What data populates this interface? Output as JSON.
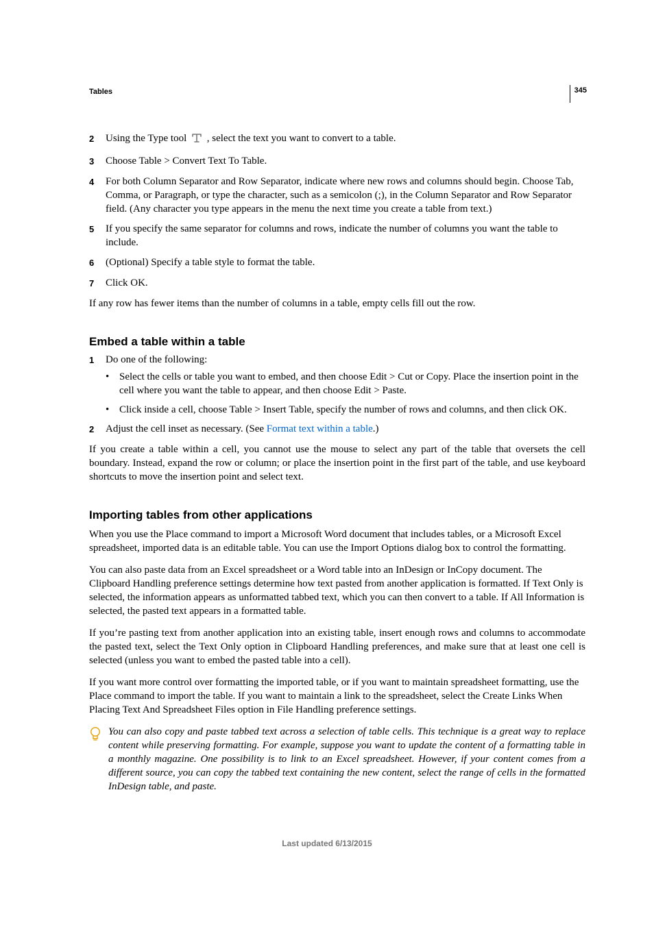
{
  "page_number": "345",
  "section": "Tables",
  "steps_a": [
    {
      "n": "2",
      "before": "Using the Type tool ",
      "after": " , select the text you want to convert to a table."
    },
    {
      "n": "3",
      "text": "Choose Table > Convert Text To Table."
    },
    {
      "n": "4",
      "text": "For both Column Separator and Row Separator, indicate where new rows and columns should begin. Choose Tab, Comma, or Paragraph, or type the character, such as a semicolon (;), in the Column Separator and Row Separator field. (Any character you type appears in the menu the next time you create a table from text.)"
    },
    {
      "n": "5",
      "text": "If you specify the same separator for columns and rows, indicate the number of columns you want the table to include."
    },
    {
      "n": "6",
      "text": "(Optional) Specify a table style to format the table."
    },
    {
      "n": "7",
      "text": "Click OK."
    }
  ],
  "para_after_a": "If any row has fewer items than the number of columns in a table, empty cells fill out the row.",
  "h2_embed": "Embed a table within a table",
  "embed_step1_intro": "Do one of the following:",
  "embed_bullets": [
    "Select the cells or table you want to embed, and then choose Edit > Cut or Copy. Place the insertion point in the cell where you want the table to appear, and then choose Edit > Paste.",
    "Click inside a cell, choose Table > Insert Table, specify the number of rows and columns, and then click OK."
  ],
  "embed_step2_before": "Adjust the cell inset as necessary. (See ",
  "embed_step2_link": "Format text within a table",
  "embed_step2_after": ".)",
  "embed_para": "If you create a table within a cell, you cannot use the mouse to select any part of the table that oversets the cell boundary. Instead, expand the row or column; or place the insertion point in the first part of the table, and use keyboard shortcuts to move the insertion point and select text.",
  "h2_import": "Importing tables from other applications",
  "import_p1": "When you use the Place command to import a Microsoft Word document that includes tables, or a Microsoft Excel spreadsheet, imported data is an editable table. You can use the Import Options dialog box to control the formatting.",
  "import_p2": "You can also paste data from an Excel spreadsheet or a Word table into an InDesign or InCopy document. The Clipboard Handling preference settings determine how text pasted from another application is formatted. If Text Only is selected, the information appears as unformatted tabbed text, which you can then convert to a table. If All Information is selected, the pasted text appears in a formatted table.",
  "import_p3": "If you’re pasting text from another application into an existing table, insert enough rows and columns to accommodate the pasted text, select the Text Only option in Clipboard Handling preferences, and make sure that at least one cell is selected (unless you want to embed the pasted table into a cell).",
  "import_p4": "If you want more control over formatting the imported table, or if you want to maintain spreadsheet formatting, use the Place command to import the table. If you want to maintain a link to the spreadsheet, select the Create Links When Placing Text And Spreadsheet Files option in File Handling preference settings.",
  "tip": "You can also copy and paste tabbed text across a selection of table cells. This technique is a great way to replace content while preserving formatting. For example, suppose you want to update the content of a formatting table in a monthly magazine. One possibility is to link to an Excel spreadsheet. However, if your content comes from a different source, you can copy the tabbed text containing the new content, select the range of cells in the formatted InDesign table, and paste.",
  "footer": "Last updated 6/13/2015"
}
